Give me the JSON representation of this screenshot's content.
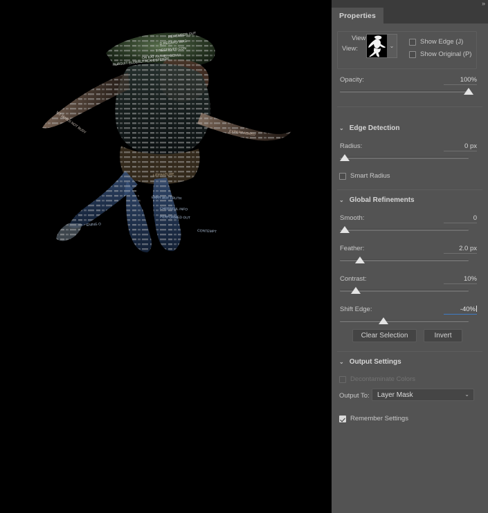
{
  "window": {
    "collapse_icon": "»"
  },
  "panel": {
    "tab_label": "Properties"
  },
  "view_mode": {
    "legend": "View Mode",
    "view_label": "View:",
    "thumbnail_icon": "figure-silhouette-thumbnail",
    "dropdown_arrow": "⌄",
    "show_edge": {
      "label": "Show Edge (J)",
      "checked": false
    },
    "show_original": {
      "label": "Show Original (P)",
      "checked": false
    }
  },
  "opacity": {
    "label": "Opacity:",
    "value": "100%",
    "percent": 100
  },
  "edge_detection": {
    "title": "Edge Detection",
    "collapse_arrow": "⌄",
    "radius": {
      "label": "Radius:",
      "value": "0 px",
      "percent": 0
    },
    "smart_radius": {
      "label": "Smart Radius",
      "checked": false
    }
  },
  "global_refinements": {
    "title": "Global Refinements",
    "collapse_arrow": "⌄",
    "smooth": {
      "label": "Smooth:",
      "value": "0",
      "percent": 0
    },
    "feather": {
      "label": "Feather:",
      "value": "2.0 px",
      "percent": 12
    },
    "contrast": {
      "label": "Contrast:",
      "value": "10%",
      "percent": 10
    },
    "shift_edge": {
      "label": "Shift Edge:",
      "value": "-40%",
      "percent": 30,
      "focused": true
    },
    "clear_selection_button": "Clear Selection",
    "invert_button": "Invert"
  },
  "output_settings": {
    "title": "Output Settings",
    "collapse_arrow": "⌄",
    "decontaminate_colors": {
      "label": "Decontaminate Colors",
      "checked": false,
      "disabled": true
    },
    "output_to": {
      "label": "Output To:",
      "value": "Layer Mask",
      "arrow": "⌄"
    },
    "remember_settings": {
      "label": "Remember Settings",
      "checked": true
    }
  },
  "canvas": {
    "artwork_name": "typographic-jumping-figure",
    "background_color": "#000000"
  },
  "colors": {
    "panel_bg": "#535353",
    "tab_bg": "#3b3b3b",
    "text": "#c9c9c9",
    "accent_focus": "#3e7cc4",
    "slider_thumb": "#e4e4e4"
  }
}
